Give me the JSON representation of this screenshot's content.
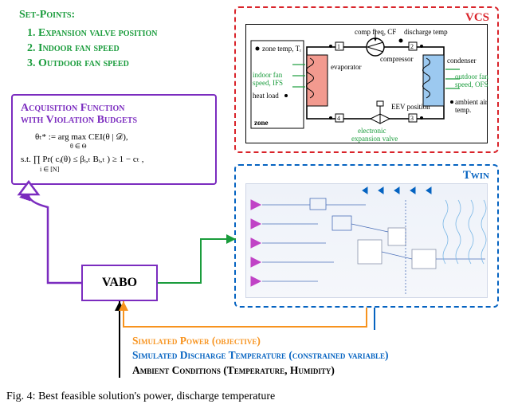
{
  "setpoints": {
    "heading": "Set-Points:",
    "items": [
      "Expansion valve position",
      "Indoor fan speed",
      "Outdoor fan speed"
    ]
  },
  "acq": {
    "title_line1": "Acquisition Function",
    "title_line2": "with Violation Budgets",
    "line1": "θₜ* := arg max  CEI(θ | 𝒟),",
    "line1_sub": "θ ∈ Θ",
    "line2": "s.t.  ∏  Pr( cᵢ(θ) ≤ βᵢ,ₜ Bᵢ,ₜ ) ≥ 1 − cₜ ,",
    "line2_sub": "i ∈ [N]"
  },
  "vabo": {
    "label": "VABO"
  },
  "vcs": {
    "panel_label": "VCS",
    "zone_text": "zone",
    "zone_temp": "zone temp, Tᵣ",
    "comp_freq": "comp freq, CF",
    "compressor": "compressor",
    "discharge_temp": "discharge temp",
    "condenser": "condenser",
    "outdoor_fan": "outdoor fan\nspeed, OFS",
    "ambient": "ambient air\ntemp.",
    "evaporator": "evaporator",
    "indoor_fan": "indoor fan\nspeed, IFS",
    "heat_load": "heat load",
    "eev_pos": "EEV position",
    "eev_label": "electronic\nexpansion valve",
    "nodes": {
      "n1": "1",
      "n2": "2",
      "n3": "3",
      "n4": "4"
    }
  },
  "twin": {
    "panel_label": "Twin"
  },
  "signals": {
    "power": "Simulated Power (objective)",
    "dtemp": "Simulated Discharge Temperature (constrained variable)",
    "ambient": "Ambient Conditions (Temperature, Humidity)"
  },
  "caption": "Fig. 4: Best feasible solution's power, discharge temperature",
  "colors": {
    "green": "#1a9c3c",
    "purple": "#7b2cbf",
    "red": "#d9232a",
    "blue": "#0563c1",
    "orange": "#f7931e",
    "evap_fill": "#f29a8f",
    "cond_fill": "#9cc9f0"
  }
}
